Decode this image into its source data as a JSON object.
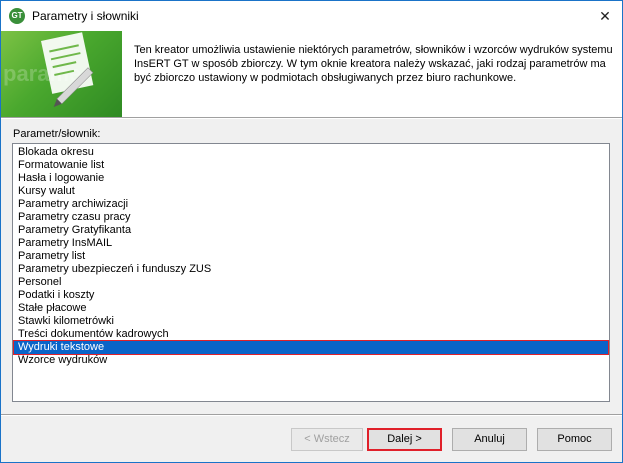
{
  "window": {
    "title": "Parametry i słowniki",
    "close_glyph": "✕",
    "app_icon_text": "GT"
  },
  "header": {
    "banner_watermark": "parame",
    "description": "Ten kreator umożliwia ustawienie niektórych parametrów, słowników i wzorców wydruków systemu InsERT GT w sposób zbiorczy. W tym oknie kreatora należy wskazać, jaki rodzaj parametrów ma być zbiorczo ustawiony w podmiotach obsługiwanych przez biuro rachunkowe."
  },
  "list": {
    "label": "Parametr/słownik:",
    "selected_index": 15,
    "items": [
      "Blokada okresu",
      "Formatowanie list",
      "Hasła i logowanie",
      "Kursy walut",
      "Parametry archiwizacji",
      "Parametry czasu pracy",
      "Parametry Gratyfikanta",
      "Parametry InsMAIL",
      "Parametry list",
      "Parametry ubezpieczeń i funduszy ZUS",
      "Personel",
      "Podatki i koszty",
      "Stałe płacowe",
      "Stawki kilometrówki",
      "Treści dokumentów kadrowych",
      "Wydruki tekstowe",
      "Wzorce wydruków"
    ]
  },
  "buttons": {
    "back": "< Wstecz",
    "next": "Dalej >",
    "cancel": "Anuluj",
    "help": "Pomoc"
  },
  "colors": {
    "selection": "#0a64c8",
    "highlight_border": "#e0202a",
    "banner_green": "#4aa82e"
  }
}
